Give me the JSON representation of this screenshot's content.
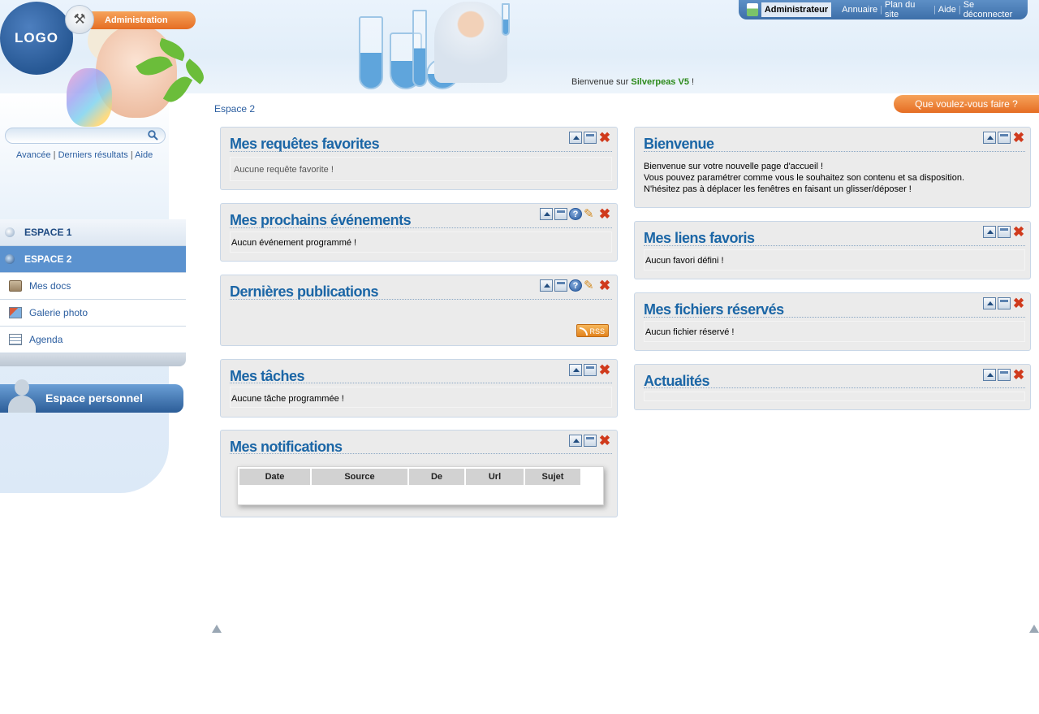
{
  "header": {
    "logo_text": "LOGO",
    "admin_label": "Administration",
    "welcome_prefix": "Bienvenue sur ",
    "welcome_brand": "Silverpeas V5",
    "welcome_suffix": " !",
    "user_name": "Administrateur",
    "links": [
      "Annuaire",
      "Plan du site",
      "Aide",
      "Se déconnecter"
    ],
    "quoi_faire": "Que voulez-vous faire ?",
    "breadcrumb": "Espace 2"
  },
  "search": {
    "value": "",
    "links": [
      "Avancée",
      "Derniers résultats",
      "Aide"
    ]
  },
  "spaces": {
    "items": [
      {
        "label": "ESPACE 1"
      },
      {
        "label": "ESPACE 2"
      }
    ],
    "subitems": [
      {
        "label": "Mes docs",
        "icon": "folder-icon"
      },
      {
        "label": "Galerie photo",
        "icon": "gallery-icon"
      },
      {
        "label": "Agenda",
        "icon": "calendar-icon"
      }
    ],
    "personal": "Espace personnel"
  },
  "portlets": {
    "requetes": {
      "title": "Mes requêtes favorites",
      "body": "Aucune requête favorite !"
    },
    "evenements": {
      "title": "Mes prochains événements",
      "body": "Aucun événement programmé !"
    },
    "publications": {
      "title": "Dernières publications",
      "rss": "RSS"
    },
    "taches": {
      "title": "Mes tâches",
      "body": "Aucune tâche programmée !"
    },
    "notifications": {
      "title": "Mes notifications",
      "columns": [
        "Date",
        "Source",
        "De",
        "Url",
        "Sujet"
      ]
    },
    "bienvenue": {
      "title": "Bienvenue",
      "lines": [
        "Bienvenue sur votre nouvelle page d'accueil !",
        "Vous pouvez paramétrer comme vous le souhaitez son contenu et sa disposition.",
        "N'hésitez pas à déplacer les fenêtres en faisant un glisser/déposer !"
      ]
    },
    "liens": {
      "title": "Mes liens favoris",
      "body": "Aucun favori défini !"
    },
    "fichiers": {
      "title": "Mes fichiers réservés",
      "body": "Aucun fichier réservé !"
    },
    "actualites": {
      "title": "Actualités"
    }
  },
  "colors": {
    "accent": "#1b66a6",
    "orange": "#e56d23",
    "brand_green": "#2c8a1a"
  }
}
